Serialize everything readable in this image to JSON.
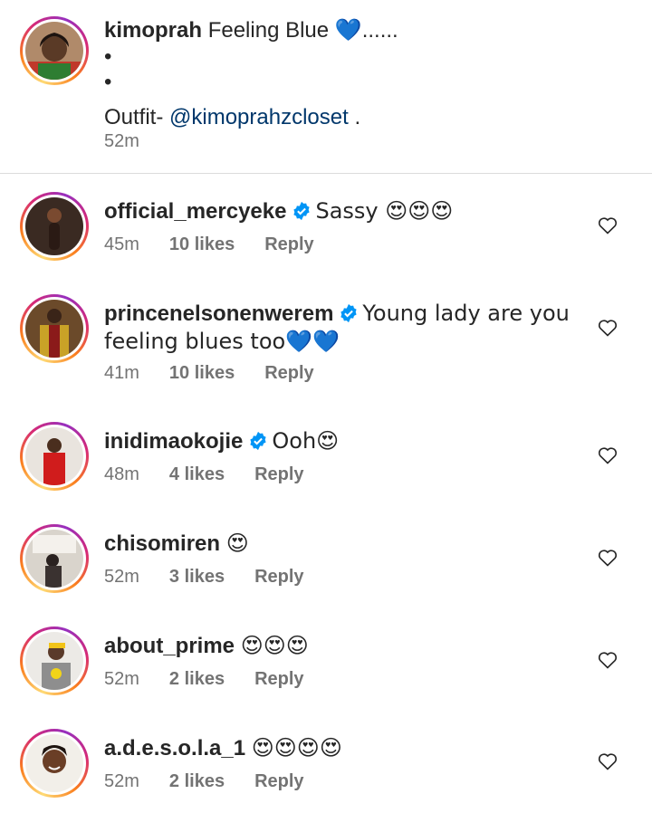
{
  "post": {
    "username": "kimoprah",
    "caption_text": "Feeling Blue",
    "caption_emoji": "💙",
    "caption_trail": "......",
    "dot1": "•",
    "dot2": "•",
    "outfit_label": "Outfit- ",
    "mention": "@kimoprahzcloset",
    "outfit_trail": " .",
    "time": "52m"
  },
  "comments": [
    {
      "username": "official_mercyeke",
      "verified": true,
      "text": "Sassy 😍😍😍",
      "time": "45m",
      "likes": "10 likes",
      "reply": "Reply"
    },
    {
      "username": "princenelsonenwerem",
      "verified": true,
      "text": "Young lady are you feeling blues too💙💙",
      "time": "41m",
      "likes": "10 likes",
      "reply": "Reply"
    },
    {
      "username": "inidimaokojie",
      "verified": true,
      "text": "Ooh😍",
      "time": "48m",
      "likes": "4 likes",
      "reply": "Reply"
    },
    {
      "username": "chisomiren",
      "verified": false,
      "text": "😍",
      "time": "52m",
      "likes": "3 likes",
      "reply": "Reply"
    },
    {
      "username": "about_prime",
      "verified": false,
      "text": "😍😍😍",
      "time": "52m",
      "likes": "2 likes",
      "reply": "Reply"
    },
    {
      "username": "a.d.e.s.o.l.a_1",
      "verified": false,
      "text": "😍😍😍😍",
      "time": "52m",
      "likes": "2 likes",
      "reply": "Reply"
    }
  ],
  "icons": {
    "like": "heart-outline-icon",
    "verified": "verified-badge-icon"
  },
  "colors": {
    "text": "#262626",
    "secondary": "#737373",
    "mention": "#00376b",
    "verified": "#0095f6"
  }
}
